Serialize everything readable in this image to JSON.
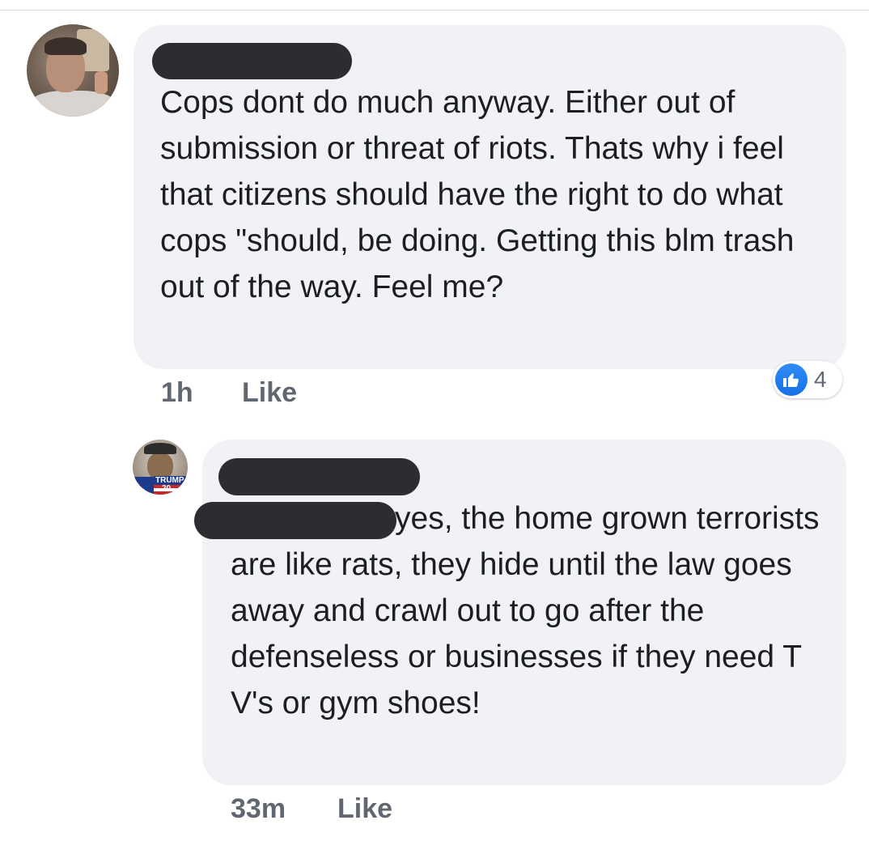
{
  "comments": [
    {
      "text": "Cops dont do much anyway. Either out of submission or threat of riots. Thats why i feel that citizens should have the right to do what cops \"should, be doing. Getting this blm trash out of the way. Feel me?",
      "time": "1h",
      "like_label": "Like",
      "reaction_count": "4",
      "reaction_icon": "like-thumb-icon"
    },
    {
      "text": "yes, the home grown terrorists are like rats, they hide until the law goes away and crawl out to go after the defenseless or businesses if they need T V's or gym shoes!",
      "time": "33m",
      "like_label": "Like"
    }
  ],
  "avatar_2_badge": {
    "name": "TRUMP",
    "year": "20"
  },
  "colors": {
    "bubble": "#f0f2f5",
    "redaction": "#2b2d31",
    "meta_text": "#606770",
    "like_blue": "#1877f2"
  }
}
